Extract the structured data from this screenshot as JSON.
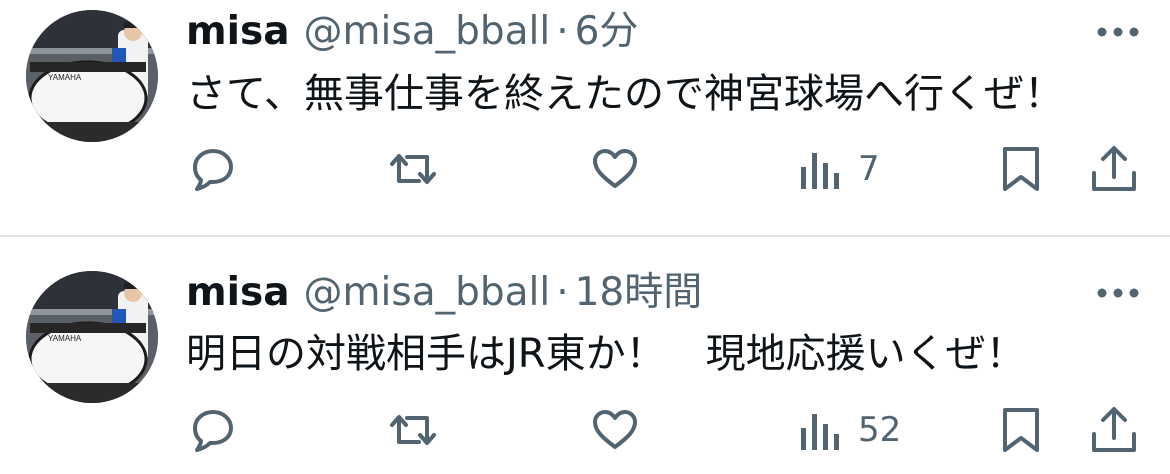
{
  "tweets": [
    {
      "name": "misa",
      "handle": "@misa_bball",
      "separator": "·",
      "time": "6分",
      "text": "さて、無事仕事を終えたので神宮球場へ行くぜ！",
      "views": "7",
      "icons": [
        "reply-icon",
        "retweet-icon",
        "like-icon",
        "views-icon",
        "bookmark-icon",
        "share-icon",
        "more-icon"
      ]
    },
    {
      "name": "misa",
      "handle": "@misa_bball",
      "separator": "·",
      "time": "18時間",
      "text": "明日の対戦相手はJR東か！　現地応援いくぜ！",
      "views": "52",
      "icons": [
        "reply-icon",
        "retweet-icon",
        "like-icon",
        "views-icon",
        "bookmark-icon",
        "share-icon",
        "more-icon"
      ]
    }
  ],
  "avatar_drum_text": "YAMAHA",
  "colors": {
    "primary_text": "#0f1419",
    "secondary_text": "#536471",
    "divider": "#e3e6e9",
    "icon": "#536471"
  }
}
